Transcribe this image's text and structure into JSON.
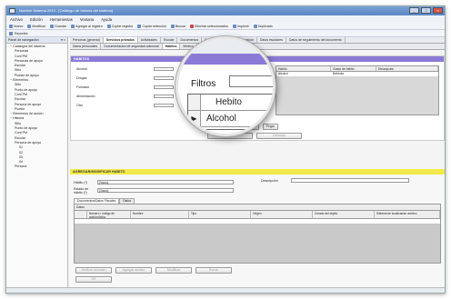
{
  "window": {
    "title": "Nombre Sistema 2013 - [Catálogo de Valores del sistema]",
    "controls": [
      "_",
      "□",
      "×"
    ]
  },
  "menu": [
    "Archivo",
    "Edición",
    "Herramientas",
    "Ventana",
    "Ayuda"
  ],
  "toolbar": [
    {
      "icon": "new-icon",
      "label": "Nuevo"
    },
    {
      "icon": "edit-icon",
      "label": "Modificar"
    },
    {
      "icon": "save-icon",
      "label": "Guardar"
    },
    {
      "icon": "add-icon",
      "label": "Agregar al registro"
    },
    {
      "icon": "copy-icon",
      "label": "Copiar registro"
    },
    {
      "icon": "copy-icon",
      "label": "Copiar selección"
    },
    {
      "icon": "search-icon",
      "label": "Buscar"
    },
    {
      "icon": "delete-icon",
      "label": "Eliminar seleccionados"
    },
    {
      "icon": "print-icon",
      "label": "Imprimir"
    },
    {
      "icon": "duplicate-icon",
      "label": "Duplicado"
    },
    {
      "icon": "close-icon",
      "label": "Cerrar"
    }
  ],
  "toolbar2": {
    "label": "Reportes"
  },
  "left_panel": {
    "header": "Panel de navegación",
    "pin": "▾ ×",
    "tree": [
      {
        "level": 1,
        "label": "Catálogos del sistema"
      },
      {
        "level": 2,
        "label": "Personas"
      },
      {
        "level": 2,
        "label": "Cont PM"
      },
      {
        "level": 2,
        "label": "Personas de apoyo"
      },
      {
        "level": 2,
        "label": "Escolar"
      },
      {
        "level": 2,
        "label": "Sitio"
      },
      {
        "level": 2,
        "label": "Puesto de apoyo"
      },
      {
        "level": 1,
        "label": "Elementos"
      },
      {
        "level": 2,
        "label": "Sitio"
      },
      {
        "level": 2,
        "label": "Punto de apoyo"
      },
      {
        "level": 2,
        "label": "Cont PM"
      },
      {
        "level": 2,
        "label": "Escolar"
      },
      {
        "level": 2,
        "label": "Persona de apoyo"
      },
      {
        "level": 2,
        "label": "Puesto"
      },
      {
        "level": 1,
        "label": "Elementos de acción"
      },
      {
        "level": 1,
        "label": "Historia"
      },
      {
        "level": 2,
        "label": "Sitio"
      },
      {
        "level": 2,
        "label": "Punto de apoyo"
      },
      {
        "level": 2,
        "label": "Cont PM"
      },
      {
        "level": 2,
        "label": "Escolar"
      },
      {
        "level": 2,
        "label": "Persona de apoyo"
      },
      {
        "level": 3,
        "label": "01"
      },
      {
        "level": 3,
        "label": "02"
      },
      {
        "level": 3,
        "label": "03"
      },
      {
        "level": 3,
        "label": "04"
      },
      {
        "level": 2,
        "label": "Persona"
      }
    ]
  },
  "tabs": [
    "Personas (general)",
    "Servicios privados",
    "Actividades",
    "Escolar",
    "Documentos"
  ],
  "tabs_right": [
    "Datos de archivo",
    "Identificación",
    "Datos escolares",
    "Datos de seguimiento del documento"
  ],
  "subtabs": [
    "Datos personales",
    "Documentación de seguridad adicional",
    "Hábitos",
    "Médico",
    "Social",
    "Tabla",
    "Estilo, perfiles"
  ],
  "top_section": {
    "header": "HABITOS",
    "fields": [
      "Alcohol",
      "Drogas",
      "Fumador",
      "Alimentación",
      "Otro"
    ],
    "grid_cols": [
      "Hábito",
      "Grado de hábito",
      "Descripción"
    ],
    "grid_rows": [
      [
        "Alcohol",
        "Bebedor",
        ""
      ]
    ],
    "buttons": [
      "Agregar a la lista",
      "Copiar",
      "Pegar"
    ],
    "buttons2": [
      "OK",
      "Cancelar"
    ]
  },
  "yellow_section": {
    "header": "AGREGAR/MODIFICAR HABITO",
    "fields": [
      {
        "label": "Hábito (*)",
        "value": "[Vacío]"
      },
      {
        "label": "Estado de hábito (*)",
        "value": "[Vacío]"
      }
    ],
    "right_label": "Descripción",
    "tabs": [
      "Documentos/Datos Fiscales",
      "Datos"
    ],
    "grid_caption": "Datos",
    "grid_cols": [
      "Número / código de archivo/ficha",
      "Nombre",
      "Tipo",
      "Origen",
      "Creado del objeto",
      "Sistema de localización archivo"
    ],
    "buttons": [
      "Verificar resumen",
      "Agregar archivo",
      "Modificar",
      "Borrar"
    ],
    "buttons2": [
      "OK"
    ]
  },
  "magnifier": {
    "label": "Filtros",
    "grid_rows": [
      "Hebito",
      "Alcohol"
    ],
    "row_marker": "▶"
  }
}
